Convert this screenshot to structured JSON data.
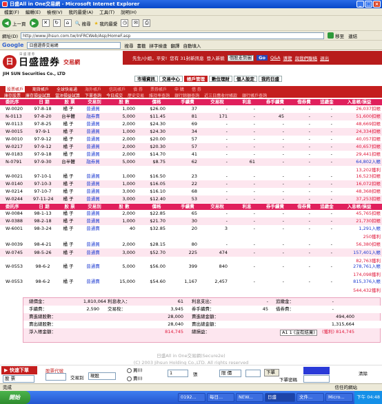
{
  "window": {
    "title": "日盛All in One交易網 - Microsoft Internet Explorer",
    "btns": [
      "_",
      "□",
      "×"
    ]
  },
  "menu": [
    "檔案(F)",
    "編輯(E)",
    "檢視(V)",
    "我的最愛(A)",
    "工具(T)",
    "說明(H)"
  ],
  "toolbar": {
    "back": "上一頁",
    "search": "搜尋",
    "favorites": "我的最愛"
  },
  "address": {
    "label": "網址(D)",
    "url": "http://www.jihsun.com.tw/InFRCWeb/Asp/HomeF.asp",
    "go": "移至",
    "links": "連結"
  },
  "google": {
    "logo": "Google",
    "query": "日盛證券交易網",
    "btn": "搜尋",
    "items": [
      "書籤",
      "拼字檢查",
      "翻譯",
      "自動填入"
    ]
  },
  "site": {
    "logo_mark": "日",
    "logo_small": "日 盛 證 券",
    "logo": "日盛證券",
    "logo_sub": "交易網",
    "en": "JIH SUN Securities Co., LTD",
    "greeting": "先生/小姐，平安!",
    "msg_count": "您有 31封新訊息",
    "login": "登入新貌",
    "select": "個股走勢圖",
    "go": "Go",
    "links": [
      "Q&A",
      "導覽",
      "與我們聯絡",
      "退出"
    ],
    "tabs": [
      "市場資訊",
      "交易中心",
      "帳戶管理",
      "數位理財",
      "個人設定",
      "我的日盛"
    ],
    "sub1": [
      "股票帳戶",
      "期貨帳戶",
      "全球快易通",
      "海外帳戶",
      "信託帳戶",
      "債 券",
      "票券帳戶",
      "申 購",
      "借 券"
    ],
    "sub2": [
      "庫存股票",
      "庫存損益試算",
      "當沖損益試算",
      "下單查詢",
      "今日成交",
      "歷史交易",
      "維持率查詢",
      "銀行餘額查詢",
      "近三日應收付帳款",
      "銀行帳戶查詢"
    ]
  },
  "table": {
    "headers": [
      "委託序",
      "日 期",
      "股 票",
      "交易別",
      "股 數",
      "價格",
      "手續費",
      "交易稅",
      "利息",
      "券手續費",
      "借券費",
      "追繳金",
      "入息帳/損益"
    ],
    "block1": [
      {
        "id": "W-0020",
        "date": "97-8-18",
        "stock": "橘 子",
        "type": "普通買",
        "qty": "1,000",
        "price": "$26.00",
        "fee": "37",
        "tax": "-",
        "int": "-",
        "sfee": "-",
        "bfee": "-",
        "margin": "-",
        "pnl": "26,037扣帳"
      },
      {
        "id": "N-0113",
        "date": "97-8-20",
        "stock": "台半體",
        "type": "融券賣",
        "qty": "5,000",
        "price": "$11.45",
        "fee": "81",
        "tax": "171",
        "int": "-",
        "sfee": "45",
        "bfee": "-",
        "margin": "-",
        "pnl": "51,600扣帳"
      },
      {
        "id": "W-0113",
        "date": "97-8-25",
        "stock": "橘 子",
        "type": "普通買",
        "qty": "2,000",
        "price": "$24.30",
        "fee": "69",
        "tax": "-",
        "int": "-",
        "sfee": "-",
        "bfee": "-",
        "margin": "-",
        "pnl": "48,669扣帳"
      },
      {
        "id": "W-0015",
        "date": "97-9-1",
        "stock": "橘 子",
        "type": "普通買",
        "qty": "1,000",
        "price": "$24.30",
        "fee": "34",
        "tax": "-",
        "int": "-",
        "sfee": "-",
        "bfee": "-",
        "margin": "-",
        "pnl": "24,334扣帳"
      },
      {
        "id": "W-0010",
        "date": "97-9-12",
        "stock": "橘 子",
        "type": "普通買",
        "qty": "2,000",
        "price": "$20.00",
        "fee": "57",
        "tax": "-",
        "int": "-",
        "sfee": "-",
        "bfee": "-",
        "margin": "-",
        "pnl": "40,057扣帳"
      },
      {
        "id": "W-0217",
        "date": "97-9-12",
        "stock": "橘 子",
        "type": "普通買",
        "qty": "2,000",
        "price": "$20.30",
        "fee": "57",
        "tax": "-",
        "int": "-",
        "sfee": "-",
        "bfee": "-",
        "margin": "-",
        "pnl": "40,657扣帳"
      },
      {
        "id": "W-0183",
        "date": "97-9-18",
        "stock": "橘 子",
        "type": "普通買",
        "qty": "2,000",
        "price": "$14.70",
        "fee": "41",
        "tax": "-",
        "int": "-",
        "sfee": "-",
        "bfee": "-",
        "margin": "-",
        "pnl": "29,441扣帳"
      },
      {
        "id": "N-0791",
        "date": "97-9-30",
        "stock": "台半體",
        "type": "融券買",
        "qty": "5,000",
        "price": "$8.75",
        "fee": "62",
        "tax": "-",
        "int": "61",
        "sfee": "-",
        "bfee": "-",
        "margin": "-",
        "pnl": "64,802入帳"
      }
    ],
    "block1_extra": "13,202獲利",
    "block2": [
      {
        "id": "W-0021",
        "date": "97-10-1",
        "stock": "橘 子",
        "type": "普通買",
        "qty": "1,000",
        "price": "$16.50",
        "fee": "23",
        "tax": "-",
        "int": "-",
        "sfee": "-",
        "bfee": "-",
        "margin": "-",
        "pnl": "16,523扣帳"
      },
      {
        "id": "W-0140",
        "date": "97-10-3",
        "stock": "橘 子",
        "type": "普通買",
        "qty": "1,000",
        "price": "$16.05",
        "fee": "22",
        "tax": "-",
        "int": "-",
        "sfee": "-",
        "bfee": "-",
        "margin": "-",
        "pnl": "16,072扣帳"
      },
      {
        "id": "W-0214",
        "date": "97-10-7",
        "stock": "橘 子",
        "type": "普通買",
        "qty": "3,000",
        "price": "$16.10",
        "fee": "68",
        "tax": "-",
        "int": "-",
        "sfee": "-",
        "bfee": "-",
        "margin": "-",
        "pnl": "48,368扣帳"
      },
      {
        "id": "W-0244",
        "date": "97-11-24",
        "stock": "橘 子",
        "type": "普通買",
        "qty": "3,000",
        "price": "$12.40",
        "fee": "53",
        "tax": "-",
        "int": "-",
        "sfee": "-",
        "bfee": "-",
        "margin": "-",
        "pnl": "37,253扣帳"
      }
    ],
    "block3": [
      {
        "id": "W-0084",
        "date": "98-1-13",
        "stock": "橘 子",
        "type": "普通買",
        "qty": "2,000",
        "price": "$22.85",
        "fee": "65",
        "tax": "-",
        "int": "-",
        "sfee": "-",
        "bfee": "-",
        "margin": "-",
        "pnl": "45,765扣帳"
      },
      {
        "id": "W-0388",
        "date": "98-2-18",
        "stock": "橘 子",
        "type": "普通買",
        "qty": "1,000",
        "price": "$21.70",
        "fee": "30",
        "tax": "-",
        "int": "-",
        "sfee": "-",
        "bfee": "-",
        "margin": "-",
        "pnl": "21,730扣帳"
      },
      {
        "id": "W-6001",
        "date": "98-3-24",
        "stock": "橘 子",
        "type": "普通賣",
        "qty": "40",
        "price": "$32.85",
        "fee": "20",
        "tax": "3",
        "int": "-",
        "sfee": "-",
        "bfee": "-",
        "margin": "-",
        "pnl": "1,291入帳"
      }
    ],
    "block3_extra": "250獲利",
    "block4": [
      {
        "id": "W-0039",
        "date": "98-4-21",
        "stock": "橘 子",
        "type": "普通買",
        "qty": "2,000",
        "price": "$28.15",
        "fee": "80",
        "tax": "-",
        "int": "-",
        "sfee": "-",
        "bfee": "-",
        "margin": "-",
        "pnl": "56,380扣帳"
      },
      {
        "id": "W-0745",
        "date": "98-5-26",
        "stock": "橘 子",
        "type": "普通賣",
        "qty": "3,000",
        "price": "$52.70",
        "fee": "225",
        "tax": "474",
        "int": "-",
        "sfee": "-",
        "bfee": "-",
        "margin": "-",
        "pnl": "157,401入帳"
      }
    ],
    "block4_extra": "82,763獲利",
    "block5": [
      {
        "id": "W-0553",
        "date": "98-6-2",
        "stock": "橘 子",
        "type": "普通賣",
        "qty": "5,000",
        "price": "$56.00",
        "fee": "399",
        "tax": "840",
        "int": "-",
        "sfee": "-",
        "bfee": "-",
        "margin": "-",
        "pnl": "278,761入帳"
      }
    ],
    "block5_extra": "174,098獲利",
    "block6": [
      {
        "id": "W-0553",
        "date": "98-6-2",
        "stock": "橘 子",
        "type": "普通賣",
        "qty": "15,000",
        "price": "$54.60",
        "fee": "1,167",
        "tax": "2,457",
        "int": "-",
        "sfee": "-",
        "bfee": "-",
        "margin": "-",
        "pnl": "815,376入帳"
      }
    ],
    "block6_extra": "544,432獲利"
  },
  "summary": {
    "r1": {
      "l1": "總價金：",
      "v1": "1,810,064",
      "l2": "利息收入：",
      "v2": "61",
      "l3": "利息支出：",
      "v3": "-",
      "l4": "追繳金：",
      "v4": "-"
    },
    "r2": {
      "l1": "手續費：",
      "v1": "2,590",
      "l2": "交易稅：",
      "v2": "3,945",
      "l3": "券手續費：",
      "v3": "45",
      "l4": "借券費：",
      "v4": "-"
    },
    "r3": {
      "l1": "賣進總股數：",
      "v1": "28,000",
      "l2": "賣進總金額：",
      "v2": "494,400"
    },
    "r4": {
      "l1": "賣出總股數：",
      "v1": "28,040",
      "l2": "賣出總金額：",
      "v2": "1,315,664"
    },
    "r5": {
      "l1": "淨入帳金額：",
      "v1": "814,745",
      "l2": "總損益：",
      "v2": "(獲利) 814,745",
      "box": "A1 1 (沒有結果)"
    }
  },
  "footer": {
    "line1": "日盛All in One交易網(Secure2e)",
    "line2": "(C) 2003 Jihsun Holding Co.,LTD. All rights reserved"
  },
  "order": {
    "title": "快速下單",
    "stock_code": "股票代號",
    "product": "股 票",
    "trade_type_lbl": "交易別",
    "trade_type": "現股",
    "buy": "買(I)",
    "sell": "賣(I)",
    "qty": "1",
    "unit": "張",
    "price_type": "限 價",
    "submit": "下單",
    "pwd_lbl": "下單密碼",
    "clear": "清除"
  },
  "status": {
    "left": "完成",
    "right": "信任的網站"
  },
  "taskbar": {
    "start": "開始",
    "tasks": [
      "0192...",
      "每日...",
      "NEW...",
      "日盛",
      "文件...",
      "Micro..."
    ],
    "clock": "下午 04:48"
  },
  "colors": {
    "red": "#c41e1e",
    "pink": "#e01f5c",
    "blue": "#1c3ad1"
  }
}
